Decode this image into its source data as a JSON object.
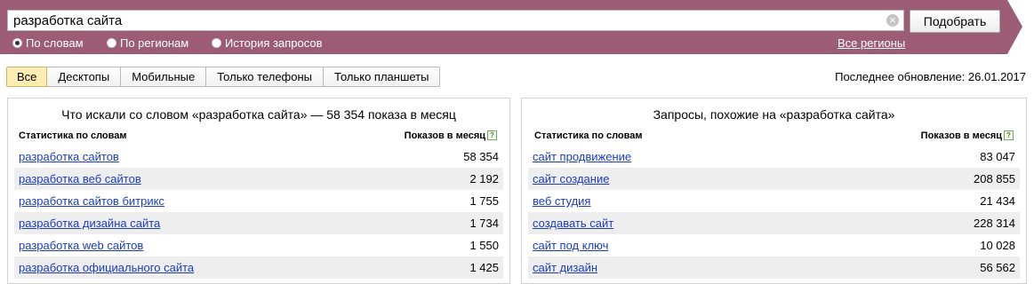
{
  "search": {
    "query": "разработка сайта",
    "clear_symbol": "×",
    "submit_label": "Подобрать",
    "modes": [
      {
        "label": "По словам",
        "checked": true
      },
      {
        "label": "По регионам",
        "checked": false
      },
      {
        "label": "История запросов",
        "checked": false
      }
    ],
    "regions_link": "Все регионы"
  },
  "colors": {
    "band": "#9b5c74",
    "link": "#1a3dc1",
    "active_tab": "#fdedb3",
    "row_alt": "#eeeeee"
  },
  "filters": {
    "tabs": [
      "Все",
      "Десктопы",
      "Мобильные",
      "Только телефоны",
      "Только планшеты"
    ],
    "active_index": 0,
    "last_update": "Последнее обновление: 26.01.2017"
  },
  "left_panel": {
    "title": "Что искали со словом «разработка сайта» — 58 354 показа в месяц",
    "col_words": "Статистика по словам",
    "col_shows": "Показов в месяц",
    "help_symbol": "?",
    "rows": [
      {
        "phrase": "разработка сайтов",
        "count": "58 354"
      },
      {
        "phrase": "разработка веб сайтов",
        "count": "2 192"
      },
      {
        "phrase": "разработка сайтов битрикс",
        "count": "1 755"
      },
      {
        "phrase": "разработка дизайна сайта",
        "count": "1 734"
      },
      {
        "phrase": "разработка web сайтов",
        "count": "1 550"
      },
      {
        "phrase": "разработка официального сайта",
        "count": "1 425"
      }
    ]
  },
  "right_panel": {
    "title": "Запросы, похожие на «разработка сайта»",
    "col_words": "Статистика по словам",
    "col_shows": "Показов в месяц",
    "help_symbol": "?",
    "rows": [
      {
        "phrase": "сайт продвижение",
        "count": "83 047"
      },
      {
        "phrase": "сайт создание",
        "count": "208 855"
      },
      {
        "phrase": "веб студия",
        "count": "21 434"
      },
      {
        "phrase": "создавать сайт",
        "count": "228 314"
      },
      {
        "phrase": "сайт под ключ",
        "count": "10 028"
      },
      {
        "phrase": "сайт дизайн",
        "count": "56 562"
      }
    ]
  }
}
